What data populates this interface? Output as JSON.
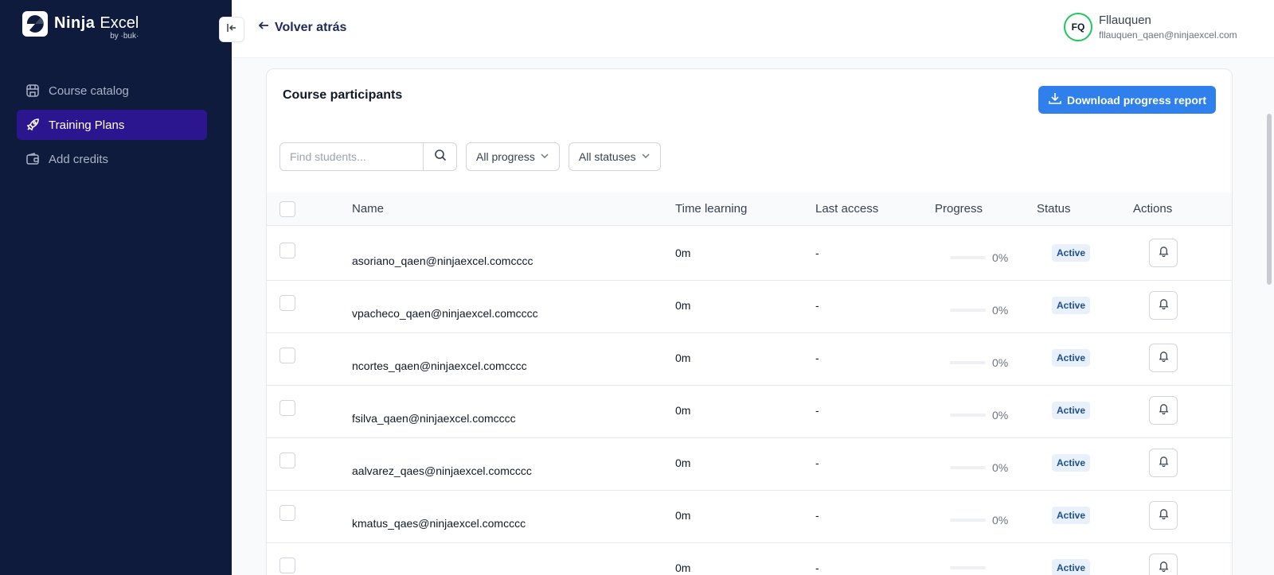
{
  "brand": {
    "name_bold": "Ninja",
    "name_light": "Excel",
    "sub": "by ·buk·"
  },
  "sidebar": {
    "items": [
      {
        "label": "Course catalog",
        "icon": "store-icon",
        "active": false
      },
      {
        "label": "Training Plans",
        "icon": "rocket-icon",
        "active": true
      },
      {
        "label": "Add credits",
        "icon": "wallet-icon",
        "active": false
      }
    ]
  },
  "header": {
    "back_label": "Volver atrás",
    "user": {
      "initials": "FQ",
      "name": "Fllauquen",
      "email": "fllauquen_qaen@ninjaexcel.com"
    }
  },
  "card": {
    "title": "Course participants",
    "download_label": "Download progress report",
    "search": {
      "placeholder": "Find students..."
    },
    "filters": {
      "progress": "All progress",
      "status": "All statuses"
    },
    "columns": {
      "name": "Name",
      "time": "Time learning",
      "last_access": "Last access",
      "progress": "Progress",
      "status": "Status",
      "actions": "Actions"
    },
    "rows": [
      {
        "name": "asoriano_qaen@ninjaexcel.comcccc",
        "time": "0m",
        "last": "-",
        "progress": 0,
        "pct": "0%",
        "status": "Active"
      },
      {
        "name": "vpacheco_qaen@ninjaexcel.comcccc",
        "time": "0m",
        "last": "-",
        "progress": 0,
        "pct": "0%",
        "status": "Active"
      },
      {
        "name": "ncortes_qaen@ninjaexcel.comcccc",
        "time": "0m",
        "last": "-",
        "progress": 0,
        "pct": "0%",
        "status": "Active"
      },
      {
        "name": "fsilva_qaen@ninjaexcel.comcccc",
        "time": "0m",
        "last": "-",
        "progress": 0,
        "pct": "0%",
        "status": "Active"
      },
      {
        "name": "aalvarez_qaes@ninjaexcel.comcccc",
        "time": "0m",
        "last": "-",
        "progress": 0,
        "pct": "0%",
        "status": "Active"
      },
      {
        "name": "kmatus_qaes@ninjaexcel.comcccc",
        "time": "0m",
        "last": "-",
        "progress": 0,
        "pct": "0%",
        "status": "Active"
      },
      {
        "name": "",
        "time": "0m",
        "last": "-",
        "progress": 0,
        "pct": "",
        "status": "Active"
      }
    ]
  },
  "colors": {
    "sidebar_bg": "#0f1b3d",
    "active_nav": "#2b168f",
    "primary": "#2f80ed",
    "avatar_ring": "#22c55e"
  }
}
